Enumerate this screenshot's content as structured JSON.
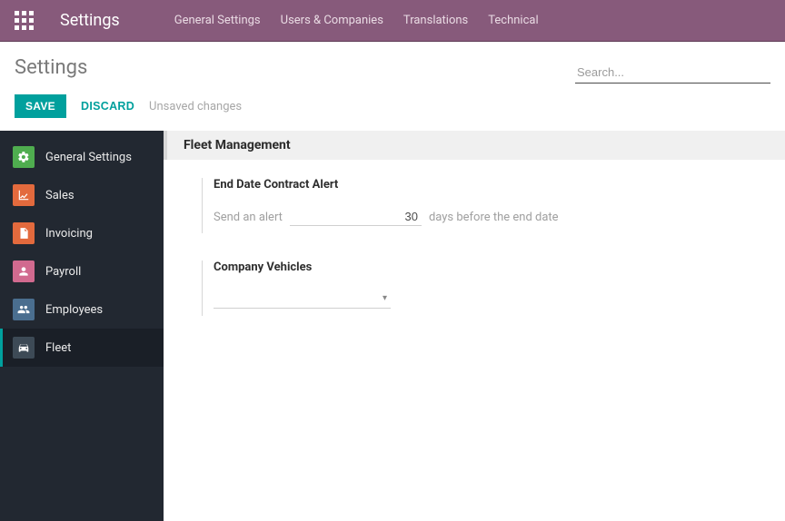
{
  "header": {
    "app_name": "Settings",
    "nav": [
      {
        "label": "General Settings"
      },
      {
        "label": "Users & Companies"
      },
      {
        "label": "Translations"
      },
      {
        "label": "Technical"
      }
    ]
  },
  "breadcrumb": {
    "title": "Settings"
  },
  "search": {
    "placeholder": "Search..."
  },
  "actions": {
    "save": "SAVE",
    "discard": "DISCARD",
    "unsaved": "Unsaved changes"
  },
  "sidebar": {
    "items": [
      {
        "label": "General Settings"
      },
      {
        "label": "Sales"
      },
      {
        "label": "Invoicing"
      },
      {
        "label": "Payroll"
      },
      {
        "label": "Employees"
      },
      {
        "label": "Fleet"
      }
    ]
  },
  "section": {
    "title": "Fleet Management",
    "contract_alert": {
      "label": "End Date Contract Alert",
      "prefix": "Send an alert",
      "value": "30",
      "suffix": "days before the end date"
    },
    "company_vehicles": {
      "label": "Company Vehicles",
      "value": ""
    }
  }
}
